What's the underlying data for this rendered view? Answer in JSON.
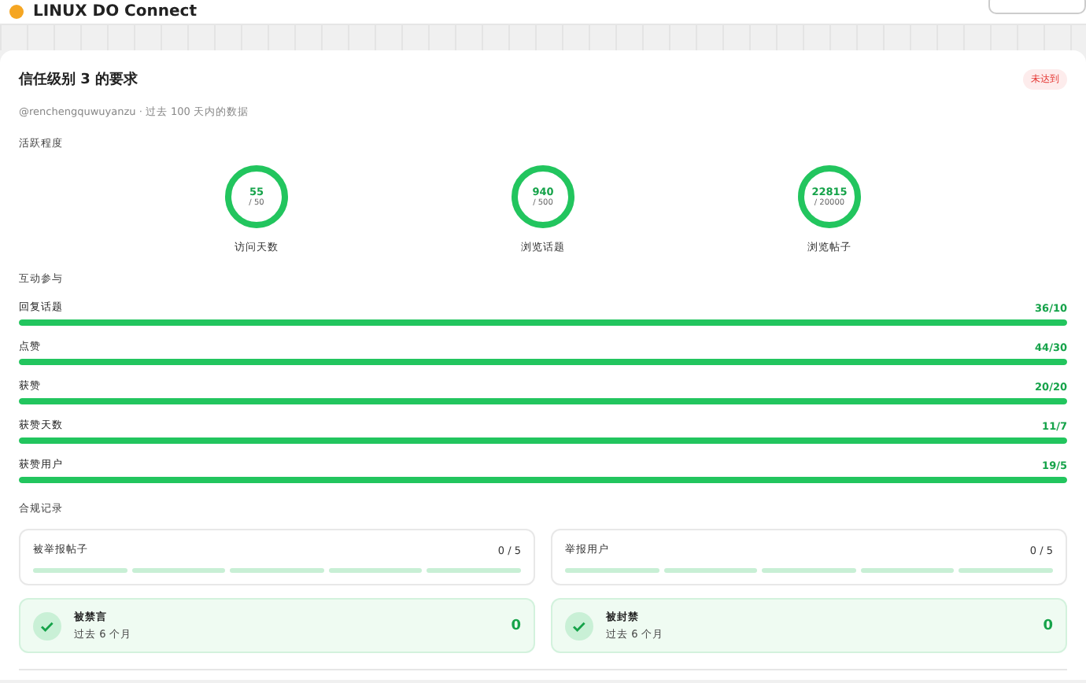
{
  "header": {
    "title": "LINUX DO Connect"
  },
  "card": {
    "title": "信任级别 3 的要求",
    "badge": "未达到",
    "subtitle": "@renchengquwuyanzu · 过去 100 天内的数据"
  },
  "activity": {
    "label": "活跃程度",
    "rings": [
      {
        "value": "55",
        "target": "/ 50",
        "name": "访问天数",
        "level": 1
      },
      {
        "value": "940",
        "target": "/ 500",
        "name": "浏览话题",
        "level": 1
      },
      {
        "value": "22815",
        "target": "/ 20000",
        "name": "浏览帖子",
        "level": 1
      }
    ]
  },
  "interaction": {
    "label": "互动参与",
    "bars": [
      {
        "name": "回复话题",
        "reading": "36/10",
        "level": 1
      },
      {
        "name": "点赞",
        "reading": "44/30",
        "level": 1
      },
      {
        "name": "获赞",
        "reading": "20/20",
        "level": 1
      },
      {
        "name": "获赞天数",
        "reading": "11/7",
        "level": 1
      },
      {
        "name": "获赞用户",
        "reading": "19/5",
        "level": 1
      }
    ]
  },
  "compliance": {
    "label": "合规记录",
    "reports": [
      {
        "name": "被举报帖子",
        "reading": "0 / 5"
      },
      {
        "name": "举报用户",
        "reading": "0 / 5"
      }
    ],
    "penalties": [
      {
        "name": "被禁言",
        "period": "过去 6 个月",
        "count": "0"
      },
      {
        "name": "被封禁",
        "period": "过去 6 个月",
        "count": "0"
      }
    ]
  }
}
